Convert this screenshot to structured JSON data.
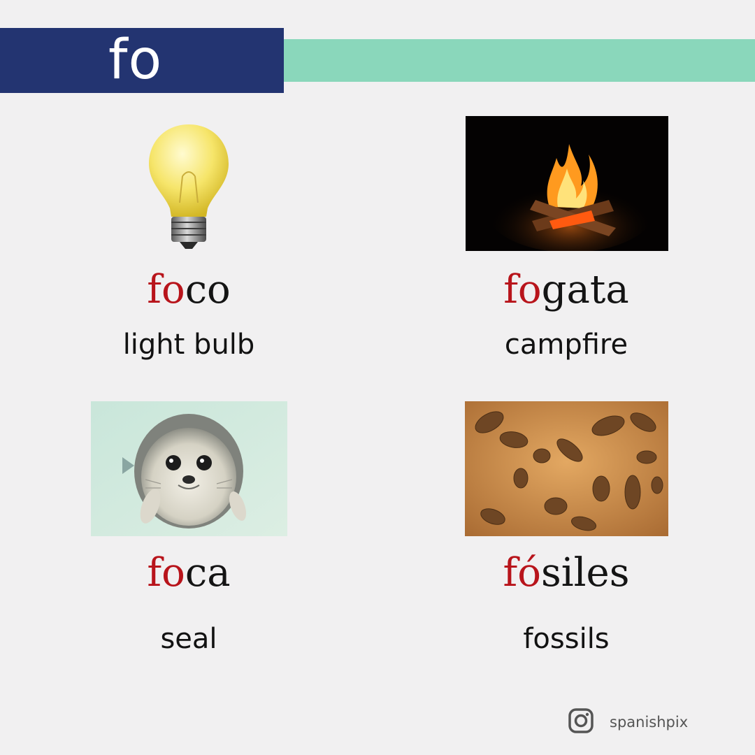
{
  "header": {
    "syllable": "fo"
  },
  "cards": [
    {
      "word_highlight": "fo",
      "word_rest": "co",
      "translation": "light bulb",
      "image": "light-bulb"
    },
    {
      "word_highlight": "fo",
      "word_rest": "gata",
      "translation": "campfire",
      "image": "campfire"
    },
    {
      "word_highlight": "fo",
      "word_rest": "ca",
      "translation": "seal",
      "image": "seal"
    },
    {
      "word_highlight": "fó",
      "word_rest": "siles",
      "translation": "fossils",
      "image": "fossils"
    }
  ],
  "footer": {
    "icon": "instagram-icon",
    "handle": "spanishpix"
  },
  "colors": {
    "header": "#233471",
    "accent": "#8ad7bb",
    "highlight": "#b8141b",
    "background": "#f1f0f1"
  }
}
